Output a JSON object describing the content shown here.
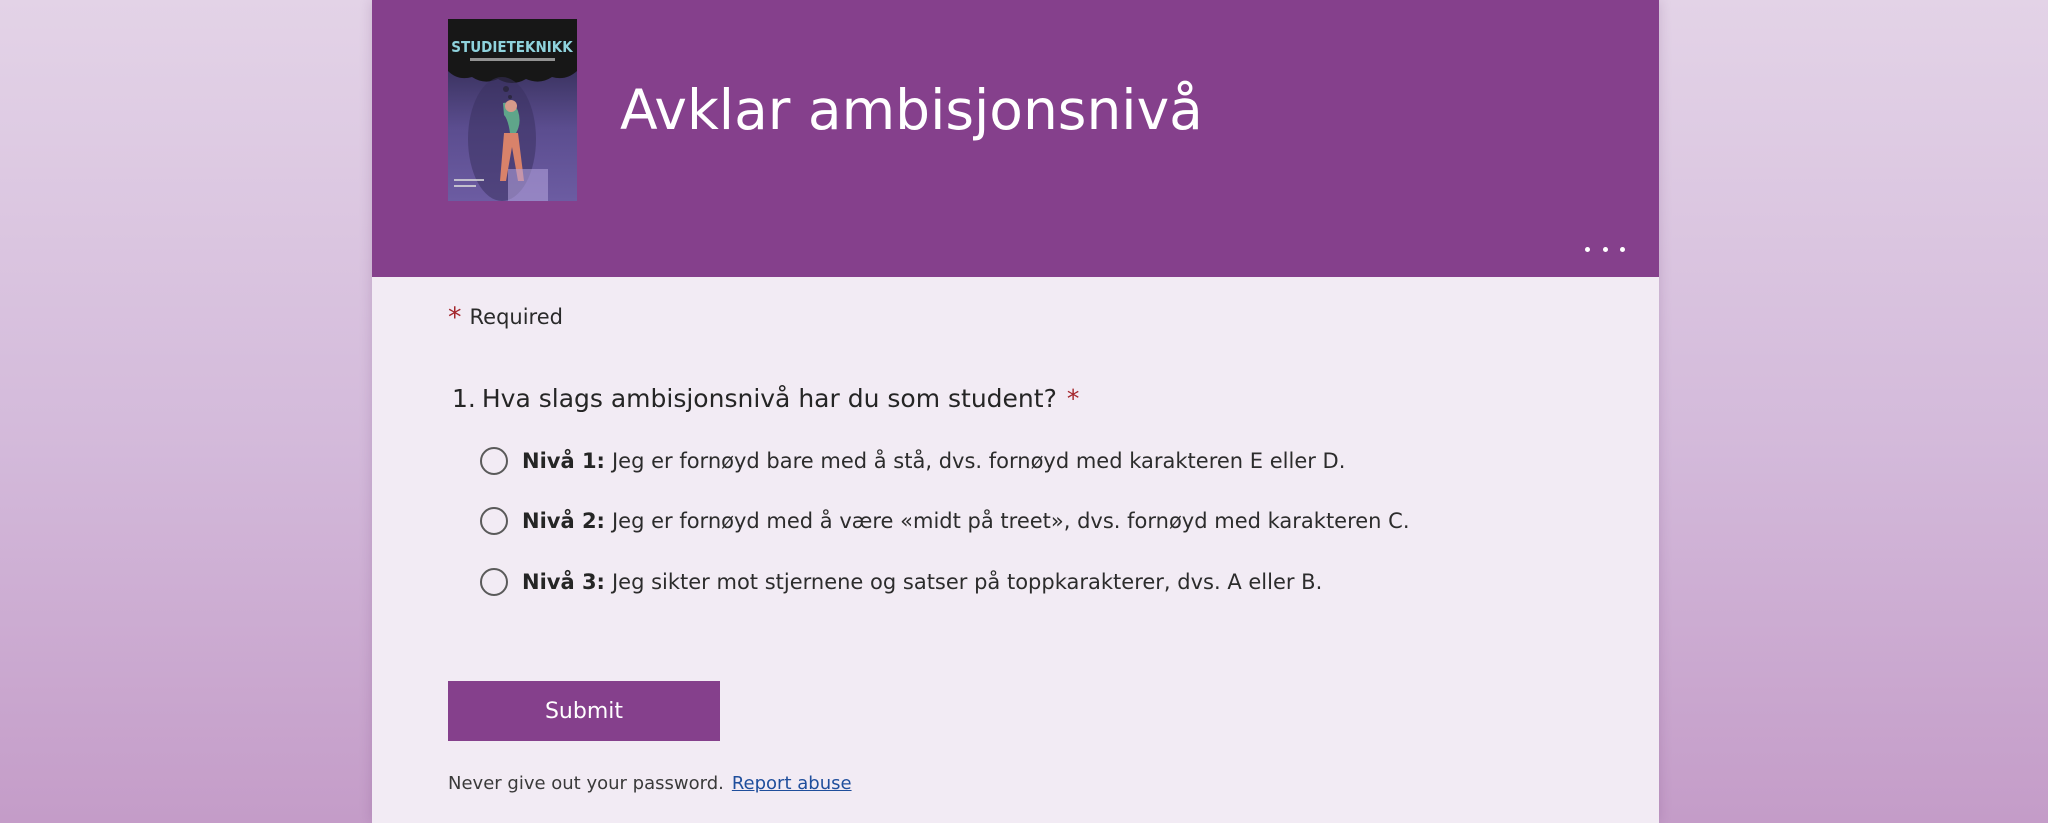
{
  "header": {
    "title": "Avklar ambisjonsnivå",
    "logo": {
      "title": "STUDIETEKNIKK",
      "icon": "book-cover-image"
    },
    "more_icon": "ellipsis-icon"
  },
  "required_note": {
    "star": "*",
    "label": "Required"
  },
  "question": {
    "number": "1.",
    "text": "Hva slags ambisjonsnivå har du som student?",
    "required_star": "*",
    "options": [
      {
        "bold": "Nivå 1:",
        "text": "Jeg er fornøyd bare med å stå, dvs. fornøyd med karakteren E eller D."
      },
      {
        "bold": "Nivå 2:",
        "text": "Jeg er fornøyd med å være «midt på treet», dvs. fornøyd med karakteren C."
      },
      {
        "bold": "Nivå 3:",
        "text": "Jeg sikter mot stjernene og satser på toppkarakterer, dvs. A eller B."
      }
    ]
  },
  "submit_label": "Submit",
  "footer": {
    "note": "Never give out your password.",
    "link": "Report abuse"
  },
  "colors": {
    "brand": "#85408c",
    "required": "#a4262c",
    "link": "#1f4e9c"
  }
}
